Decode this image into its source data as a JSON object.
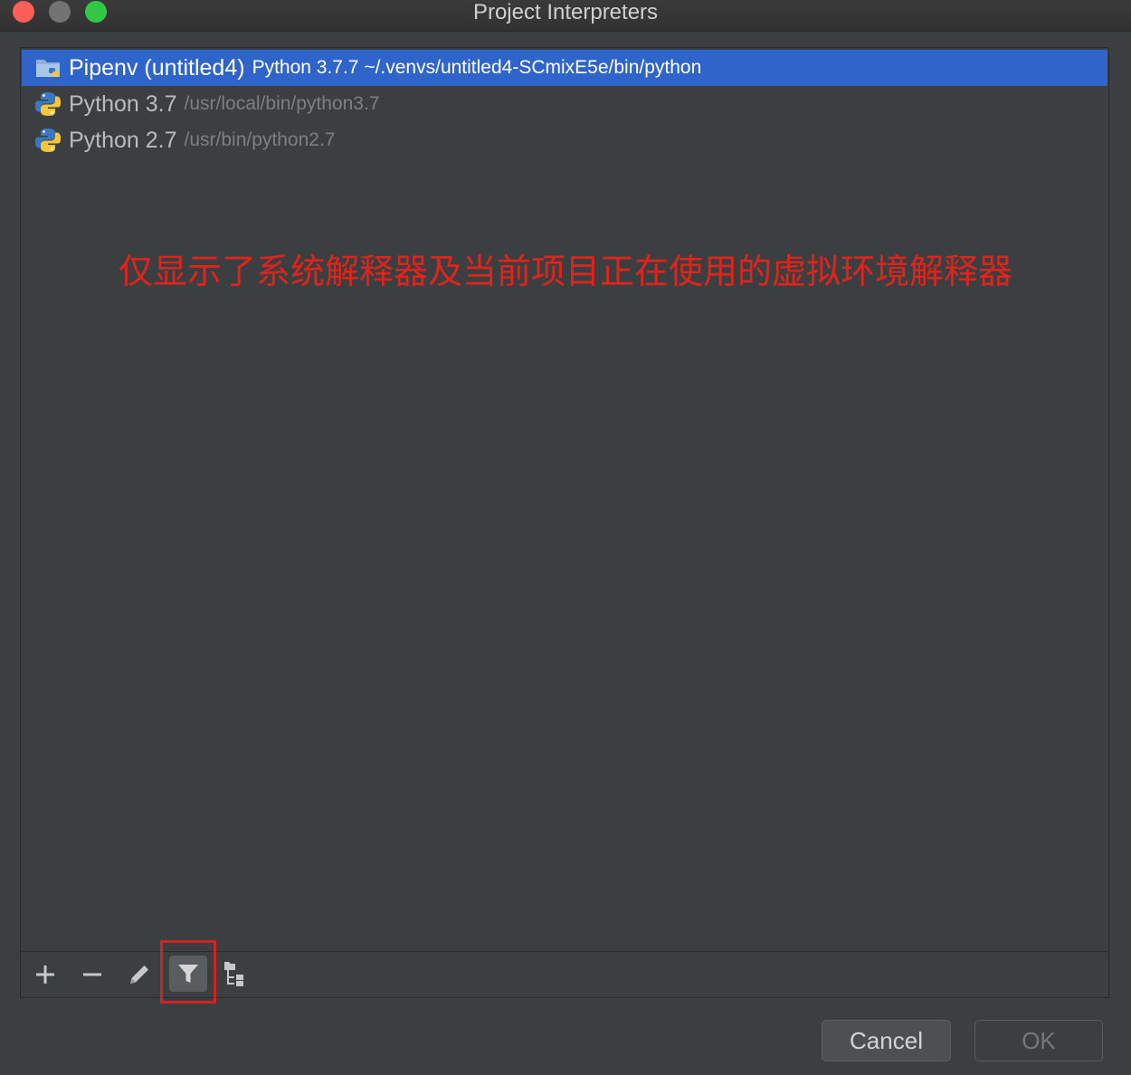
{
  "window": {
    "title": "Project Interpreters"
  },
  "interpreters": [
    {
      "name": "Pipenv (untitled4)",
      "detail": "Python 3.7.7 ~/.venvs/untitled4-SCmixE5e/bin/python",
      "icon": "pipenv-folder-icon",
      "selected": true
    },
    {
      "name": "Python 3.7",
      "detail": "/usr/local/bin/python3.7",
      "icon": "python-icon",
      "selected": false
    },
    {
      "name": "Python 2.7",
      "detail": "/usr/bin/python2.7",
      "icon": "python-icon",
      "selected": false
    }
  ],
  "annotation": {
    "text": "仅显示了系统解释器及当前项目正在使用的虚拟环境解释器",
    "color": "#e2231a"
  },
  "toolbar": {
    "icons": [
      "plus-icon",
      "minus-icon",
      "pencil-icon",
      "filter-icon",
      "tree-icon"
    ],
    "highlighted": "filter-icon"
  },
  "buttons": {
    "cancel": "Cancel",
    "ok": "OK"
  },
  "colors": {
    "selection": "#2f65ca",
    "background": "#3c3f41",
    "highlight_box": "#d32222"
  }
}
